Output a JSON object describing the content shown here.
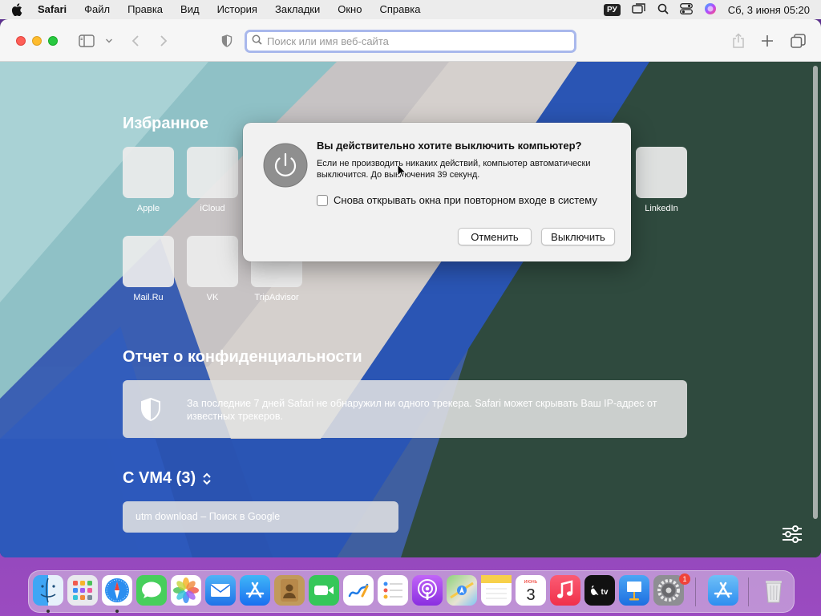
{
  "menubar": {
    "app": "Safari",
    "items": [
      "Файл",
      "Правка",
      "Вид",
      "История",
      "Закладки",
      "Окно",
      "Справка"
    ],
    "keyboard": "РУ",
    "clock": "Сб, 3 июня  05:20"
  },
  "toolbar": {
    "address_placeholder": "Поиск или имя веб-сайта"
  },
  "favorites": {
    "title": "Избранное",
    "items": [
      {
        "label": "Apple"
      },
      {
        "label": "iCloud"
      },
      {
        "label": "LinkedIn"
      },
      {
        "label": "Mail.Ru"
      },
      {
        "label": "VK"
      },
      {
        "label": "TripAdvisor"
      }
    ]
  },
  "privacy": {
    "title": "Отчет о конфиденциальности",
    "text": "За последние 7 дней Safari не обнаружил ни одного трекера. Safari может скрывать Ваш IP-адрес от известных трекеров."
  },
  "from_device": {
    "title": "С VM4 (3)",
    "tab": "utm download – Поиск в Google"
  },
  "dialog": {
    "title": "Вы действительно хотите выключить компьютер?",
    "body": "Если не производить никаких действий, компьютер автоматически выключится. До выключения 39 секунд.",
    "checkbox_label": "Снова открывать окна при повторном входе в систему",
    "checkbox_checked": false,
    "cancel": "Отменить",
    "confirm": "Выключить"
  },
  "dock": {
    "calendar_month": "июнь",
    "calendar_day": "3",
    "settings_badge": "1",
    "apps": [
      "finder-icon",
      "launchpad-icon",
      "safari-icon",
      "messages-icon",
      "photos-icon",
      "mail-icon",
      "app-store-icon",
      "contacts-icon",
      "facetime-icon",
      "freeform-icon",
      "reminders-icon",
      "podcasts-icon",
      "maps-icon",
      "notes-icon",
      "calendar-icon",
      "music-icon",
      "tv-icon",
      "keynote-icon",
      "system-settings-icon",
      "downloads-folder-icon",
      "trash-icon"
    ]
  },
  "colors": {
    "dialog_bg": "#f1f1f1",
    "address_focus": "#a9b8ec",
    "close": "#fe5f57",
    "minimize": "#febc2e",
    "maximize": "#28c840"
  }
}
